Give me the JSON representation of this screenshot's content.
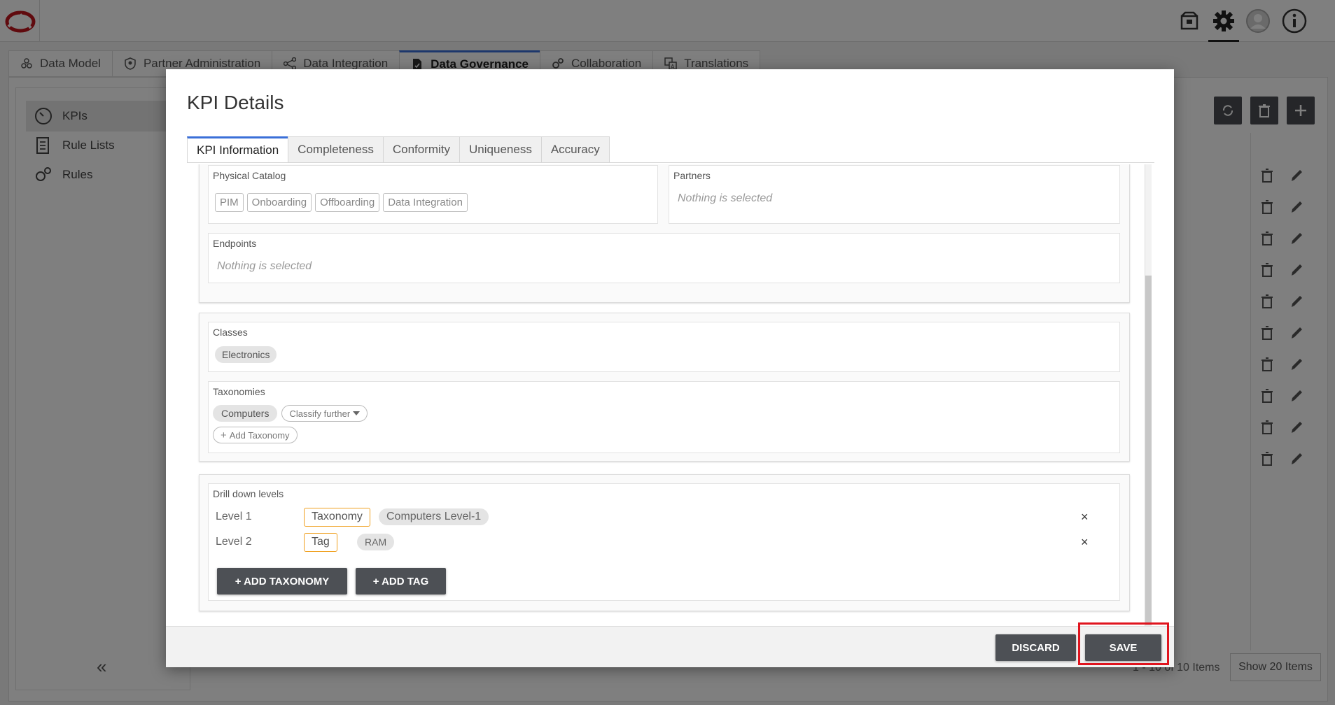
{
  "app": {
    "top_icons": [
      "package-icon",
      "gear-icon",
      "user-avatar-icon",
      "info-icon"
    ],
    "tabs": [
      {
        "label": "Data Model",
        "icon": "cube-network-icon"
      },
      {
        "label": "Partner Administration",
        "icon": "shield-icon"
      },
      {
        "label": "Data Integration",
        "icon": "share-nodes-icon"
      },
      {
        "label": "Data Governance",
        "icon": "document-check-icon"
      },
      {
        "label": "Collaboration",
        "icon": "gears-icon"
      },
      {
        "label": "Translations",
        "icon": "translate-icon"
      }
    ],
    "active_tab": "Data Governance",
    "sidebar": {
      "items": [
        {
          "label": "KPIs",
          "icon": "gauge-icon"
        },
        {
          "label": "Rule Lists",
          "icon": "list-doc-icon"
        },
        {
          "label": "Rules",
          "icon": "gears-icon"
        }
      ],
      "active": "KPIs",
      "collapse_symbol": "«"
    },
    "pager": {
      "text": "1 - 10 of 10 Items",
      "show_label": "Show 20 Items"
    }
  },
  "modal": {
    "title": "KPI Details",
    "tabs": [
      "KPI Information",
      "Completeness",
      "Conformity",
      "Uniqueness",
      "Accuracy"
    ],
    "active_tab": "KPI Information",
    "physical_catalog": {
      "label": "Physical Catalog",
      "chips": [
        "PIM",
        "Onboarding",
        "Offboarding",
        "Data Integration"
      ]
    },
    "partners": {
      "label": "Partners",
      "placeholder": "Nothing is selected"
    },
    "endpoints": {
      "label": "Endpoints",
      "placeholder": "Nothing is selected"
    },
    "classes": {
      "label": "Classes",
      "chips": [
        "Electronics"
      ]
    },
    "taxonomies": {
      "label": "Taxonomies",
      "selected": "Computers",
      "classify_label": "Classify further",
      "add_label": "Add Taxonomy"
    },
    "drill_down": {
      "label": "Drill down levels",
      "levels": [
        {
          "name": "Level 1",
          "type": "Taxonomy",
          "value": "Computers Level-1",
          "remove": "×"
        },
        {
          "name": "Level 2",
          "type": "Tag",
          "value": "RAM",
          "remove": "×"
        }
      ],
      "add_taxonomy_label": "+ ADD TAXONOMY",
      "add_tag_label": "+ ADD TAG"
    },
    "footer": {
      "discard_label": "DISCARD",
      "save_label": "SAVE"
    }
  },
  "colors": {
    "accent": "#3a6fd8",
    "highlight": "#e0141e",
    "tag_border": "#f0a020",
    "button": "#4d5055"
  }
}
